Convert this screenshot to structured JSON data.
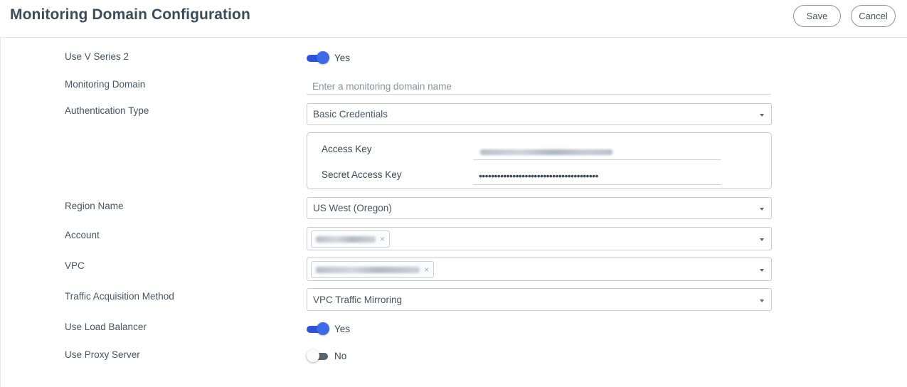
{
  "header": {
    "title": "Monitoring Domain Configuration",
    "save_label": "Save",
    "cancel_label": "Cancel"
  },
  "form": {
    "use_v_series_2": {
      "label": "Use V Series 2",
      "value": "Yes",
      "enabled": true
    },
    "monitoring_domain": {
      "label": "Monitoring Domain",
      "placeholder": "Enter a monitoring domain name",
      "value": ""
    },
    "authentication_type": {
      "label": "Authentication Type",
      "value": "Basic Credentials"
    },
    "credentials": {
      "access_key_label": "Access Key",
      "secret_access_key_label": "Secret Access Key",
      "secret_mask": "•••••••••••••••••••••••••••••••••••••••"
    },
    "region_name": {
      "label": "Region Name",
      "value": "US West (Oregon)"
    },
    "account": {
      "label": "Account",
      "chip_remove": "×"
    },
    "vpc": {
      "label": "VPC",
      "chip_remove": "×"
    },
    "traffic_acquisition_method": {
      "label": "Traffic Acquisition Method",
      "value": "VPC Traffic Mirroring"
    },
    "use_load_balancer": {
      "label": "Use Load Balancer",
      "value": "Yes",
      "enabled": true
    },
    "use_proxy_server": {
      "label": "Use Proxy Server",
      "value": "No",
      "enabled": false
    }
  },
  "colors": {
    "toggle_on": "#3e6ae8",
    "toggle_off_track": "#5b636b",
    "border": "#c4cad0",
    "text": "#48545f"
  },
  "icons": {
    "select_caret": "chevron-down-icon",
    "chip_remove": "close-icon"
  }
}
